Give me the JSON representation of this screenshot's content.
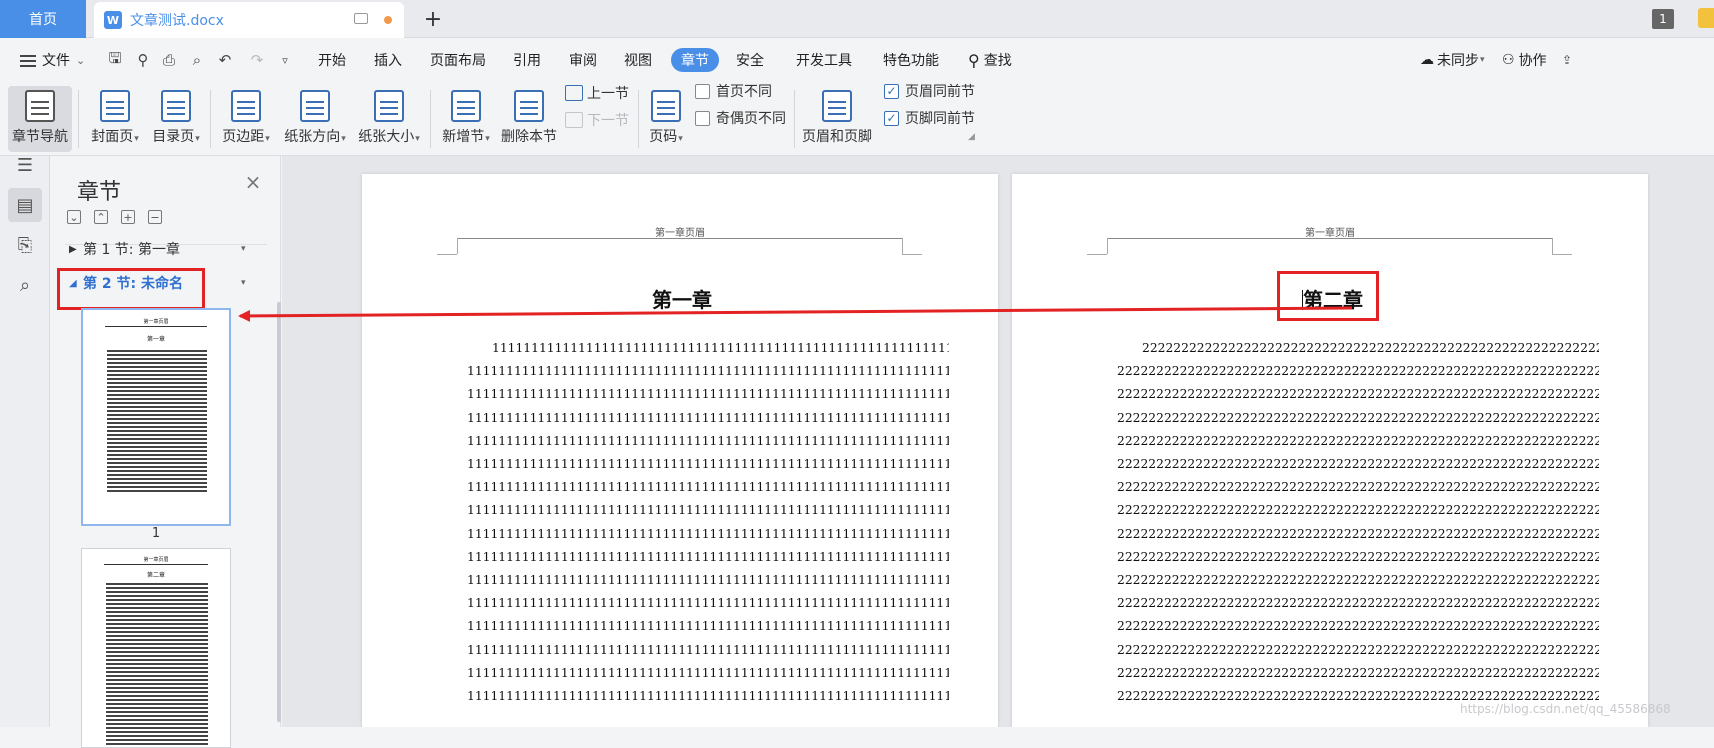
{
  "tabbar": {
    "home_label": "首页",
    "document_tab_title": "文章测试.docx",
    "new_tab_symbol": "+",
    "window_count": "1"
  },
  "menubar": {
    "file_label": "文件",
    "items": [
      "开始",
      "插入",
      "页面布局",
      "引用",
      "审阅",
      "视图",
      "章节",
      "安全",
      "开发工具",
      "特色功能"
    ],
    "active_item": "章节",
    "search_label": "查找",
    "sync_label": "未同步",
    "collab_label": "协作"
  },
  "ribbon": {
    "section_nav": "章节导航",
    "cover_page": "封面页",
    "toc_page": "目录页",
    "margins": "页边距",
    "orientation": "纸张方向",
    "paper_size": "纸张大小",
    "new_section": "新增节",
    "delete_section": "删除本节",
    "prev_section": "上一节",
    "next_section": "下一节",
    "page_number": "页码",
    "first_page_diff": "首页不同",
    "odd_even_diff": "奇偶页不同",
    "header_footer": "页眉和页脚",
    "header_same_as_prev": "页眉同前节",
    "footer_same_as_prev": "页脚同前节",
    "header_same_checked": true,
    "footer_same_checked": true,
    "first_page_checked": false,
    "odd_even_checked": false
  },
  "navpane": {
    "title": "章节",
    "sections": [
      {
        "label": "第 1 节: 第一章",
        "expanded": false
      },
      {
        "label": "第 2 节: 未命名",
        "expanded": true
      }
    ],
    "thumbnails": [
      {
        "page_number": "1",
        "heading": "第一章",
        "header": "第一章页眉"
      },
      {
        "page_number": "",
        "heading": "第二章",
        "header": "第一章页眉"
      }
    ]
  },
  "pages": [
    {
      "header_text": "第一章页眉",
      "chapter_title": "第一章",
      "first_line": "1111111111111111111111111111111111111111111111111111111111111111111",
      "line": "11111111111111111111111111111111111111111111111111111111111111111111111",
      "line_count": 16
    },
    {
      "header_text": "第一章页眉",
      "chapter_title": "第二章",
      "first_line": "2222222222222222222222222222222222222222222222222222222222222222222",
      "line": "22222222222222222222222222222222222222222222222222222222222222222222222",
      "line_count": 16
    }
  ],
  "annotation": {
    "color": "#e32323"
  },
  "watermark": "https://blog.csdn.net/qq_45586868"
}
